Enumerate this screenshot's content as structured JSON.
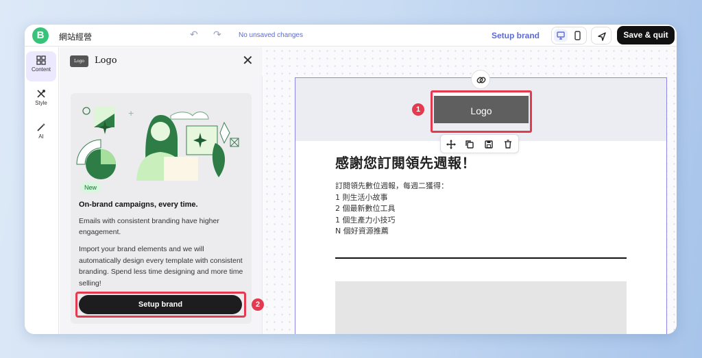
{
  "app": {
    "site_name": "網站經營",
    "logo_letter": "B",
    "unsaved_status": "No unsaved changes",
    "setup_brand_link": "Setup brand",
    "save_quit": "Save & quit",
    "brand_color": "#37c47a",
    "accent_color": "#5a6bd6"
  },
  "rail": {
    "items": [
      {
        "label": "Content",
        "icon": "grid-icon",
        "active": true
      },
      {
        "label": "Style",
        "icon": "style-brush-icon",
        "active": false
      },
      {
        "label": "AI",
        "icon": "magic-wand-icon",
        "active": false
      }
    ]
  },
  "panel": {
    "badge": "Logo",
    "title": "Logo",
    "card": {
      "pill": "New",
      "heading": "On-brand campaigns, every time.",
      "para1": "Emails with consistent branding have higher engagement.",
      "para2": "Import your brand elements and we will automatically design every template with consistent branding. Spend less time designing and more time selling!",
      "button": "Setup brand"
    }
  },
  "email": {
    "logo_text": "Logo",
    "title": "感謝您訂閱領先週報！",
    "lines": [
      "訂閱領先數位週報，每週二獲得：",
      "1 則生活小故事",
      "2 個最新數位工具",
      "1 個生產力小技巧",
      "N 個好資源推薦"
    ]
  },
  "annotations": {
    "badge1": "1",
    "badge2": "2",
    "highlight_color": "#e33a4f"
  }
}
